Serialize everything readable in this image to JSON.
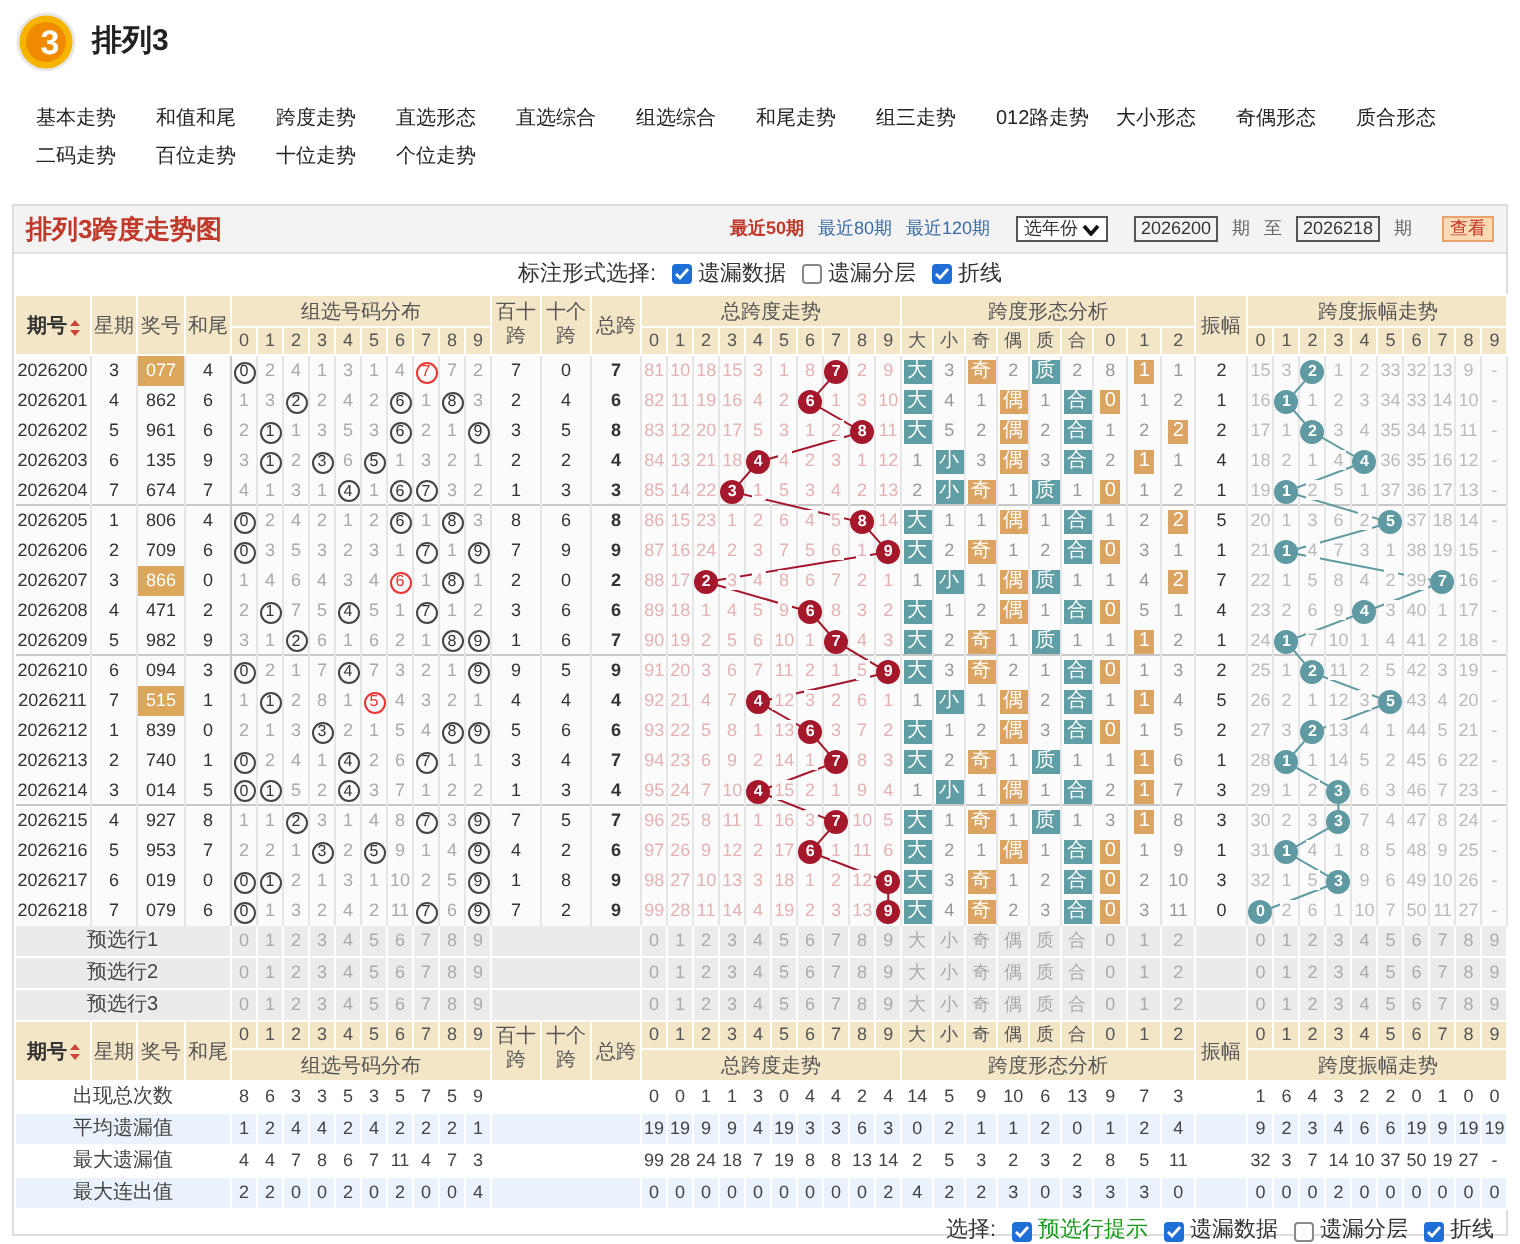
{
  "logo": {
    "text": "3"
  },
  "app_title": "排列3",
  "nav": [
    [
      "基本走势",
      "和值和尾",
      "跨度走势",
      "直选形态",
      "直选综合",
      "组选综合",
      "和尾走势",
      "组三走势",
      "012路走势",
      "大小形态",
      "奇偶形态",
      "质合形态"
    ],
    [
      "二码走势",
      "百位走势",
      "十位走势",
      "个位走势"
    ]
  ],
  "chart_title": "排列3跨度走势图",
  "ranges": [
    {
      "label": "最近50期",
      "selected": true
    },
    {
      "label": "最近80期",
      "selected": false
    },
    {
      "label": "最近120期",
      "selected": false
    }
  ],
  "year_select": "选年份",
  "from": "2026200",
  "period_unit_1": "期",
  "to_label": "至",
  "to": "2026218",
  "period_unit_2": "期",
  "view_button": "查看",
  "options_label": "标注形式选择:",
  "options": [
    {
      "label": "遗漏数据",
      "checked": true
    },
    {
      "label": "遗漏分层",
      "checked": false
    },
    {
      "label": "折线",
      "checked": true
    }
  ],
  "header": {
    "period": "期号",
    "week": "星期",
    "number": "奖号",
    "tail": "和尾",
    "dist_title": "组选号码分布",
    "dist_cols": [
      "0",
      "1",
      "2",
      "3",
      "4",
      "5",
      "6",
      "7",
      "8",
      "9"
    ],
    "bs": "百十跨",
    "sg": "十个跨",
    "span": "总跨",
    "span_title": "总跨度走势",
    "span_cols": [
      "0",
      "1",
      "2",
      "3",
      "4",
      "5",
      "6",
      "7",
      "8",
      "9"
    ],
    "form_title": "跨度形态分析",
    "form_cols": [
      "大",
      "小",
      "奇",
      "偶",
      "质",
      "合",
      "0",
      "1",
      "2"
    ],
    "amp": "振幅",
    "amp_title": "跨度振幅走势",
    "amp_cols": [
      "0",
      "1",
      "2",
      "3",
      "4",
      "5",
      "6",
      "7",
      "8",
      "9"
    ]
  },
  "rows": [
    {
      "period": "2026200",
      "week": "3",
      "number": "077",
      "highlight": true,
      "tail": "4",
      "dist": [
        {
          "text": "0",
          "kind": "hit"
        },
        "2",
        "4",
        "1",
        "3",
        "1",
        "4",
        {
          "text": "7",
          "kind": "double"
        },
        "7",
        "2"
      ],
      "bs": "7",
      "sg": "0",
      "span": "7",
      "span_trend": [
        "81",
        "10",
        "18",
        "15",
        "3",
        "1",
        "8",
        {
          "text": "7",
          "kind": "hit"
        },
        "2",
        "9"
      ],
      "form": [
        {
          "text": "大",
          "kind": "hit"
        },
        "3",
        {
          "text": "奇",
          "kind": "hit"
        },
        "2",
        {
          "text": "质",
          "kind": "hit"
        },
        "2",
        "8",
        {
          "text": "1",
          "kind": "hit"
        },
        "1"
      ],
      "amp": "2",
      "amp_trend": [
        "15",
        "3",
        {
          "text": "2",
          "kind": "hit"
        },
        "1",
        "2",
        "33",
        "32",
        "13",
        "9",
        "-"
      ]
    },
    {
      "period": "2026201",
      "week": "4",
      "number": "862",
      "highlight": false,
      "tail": "6",
      "dist": [
        "1",
        "3",
        {
          "text": "2",
          "kind": "hit"
        },
        "2",
        "4",
        "2",
        {
          "text": "6",
          "kind": "hit"
        },
        "1",
        {
          "text": "8",
          "kind": "hit"
        },
        "3"
      ],
      "bs": "2",
      "sg": "4",
      "span": "6",
      "span_trend": [
        "82",
        "11",
        "19",
        "16",
        "4",
        "2",
        {
          "text": "6",
          "kind": "hit"
        },
        "1",
        "3",
        "10"
      ],
      "form": [
        {
          "text": "大",
          "kind": "hit"
        },
        "4",
        "1",
        {
          "text": "偶",
          "kind": "hit"
        },
        "1",
        {
          "text": "合",
          "kind": "hit"
        },
        {
          "text": "0",
          "kind": "hit"
        },
        "1",
        "2"
      ],
      "amp": "1",
      "amp_trend": [
        "16",
        {
          "text": "1",
          "kind": "hit"
        },
        "1",
        "2",
        "3",
        "34",
        "33",
        "14",
        "10",
        "-"
      ]
    },
    {
      "period": "2026202",
      "week": "5",
      "number": "961",
      "highlight": false,
      "tail": "6",
      "dist": [
        "2",
        {
          "text": "1",
          "kind": "hit"
        },
        "1",
        "3",
        "5",
        "3",
        {
          "text": "6",
          "kind": "hit"
        },
        "2",
        "1",
        {
          "text": "9",
          "kind": "hit"
        }
      ],
      "bs": "3",
      "sg": "5",
      "span": "8",
      "span_trend": [
        "83",
        "12",
        "20",
        "17",
        "5",
        "3",
        "1",
        "2",
        {
          "text": "8",
          "kind": "hit"
        },
        "11"
      ],
      "form": [
        {
          "text": "大",
          "kind": "hit"
        },
        "5",
        "2",
        {
          "text": "偶",
          "kind": "hit"
        },
        "2",
        {
          "text": "合",
          "kind": "hit"
        },
        "1",
        "2",
        {
          "text": "2",
          "kind": "hit"
        }
      ],
      "amp": "2",
      "amp_trend": [
        "17",
        "1",
        {
          "text": "2",
          "kind": "hit"
        },
        "3",
        "4",
        "35",
        "34",
        "15",
        "11",
        "-"
      ]
    },
    {
      "period": "2026203",
      "week": "6",
      "number": "135",
      "highlight": false,
      "tail": "9",
      "dist": [
        "3",
        {
          "text": "1",
          "kind": "hit"
        },
        "2",
        {
          "text": "3",
          "kind": "hit"
        },
        "6",
        {
          "text": "5",
          "kind": "hit"
        },
        "1",
        "3",
        "2",
        "1"
      ],
      "bs": "2",
      "sg": "2",
      "span": "4",
      "span_trend": [
        "84",
        "13",
        "21",
        "18",
        {
          "text": "4",
          "kind": "hit"
        },
        "4",
        "2",
        "3",
        "1",
        "12"
      ],
      "form": [
        "1",
        {
          "text": "小",
          "kind": "hit"
        },
        "3",
        {
          "text": "偶",
          "kind": "hit"
        },
        "3",
        {
          "text": "合",
          "kind": "hit"
        },
        "2",
        {
          "text": "1",
          "kind": "hit"
        },
        "1"
      ],
      "amp": "4",
      "amp_trend": [
        "18",
        "2",
        "1",
        "4",
        {
          "text": "4",
          "kind": "hit"
        },
        "36",
        "35",
        "16",
        "12",
        "-"
      ]
    },
    {
      "period": "2026204",
      "week": "7",
      "number": "674",
      "highlight": false,
      "tail": "7",
      "dist": [
        "4",
        "1",
        "3",
        "1",
        {
          "text": "4",
          "kind": "hit"
        },
        "1",
        {
          "text": "6",
          "kind": "hit"
        },
        {
          "text": "7",
          "kind": "hit"
        },
        "3",
        "2"
      ],
      "bs": "1",
      "sg": "3",
      "span": "3",
      "span_trend": [
        "85",
        "14",
        "22",
        {
          "text": "3",
          "kind": "hit"
        },
        "1",
        "5",
        "3",
        "4",
        "2",
        "13"
      ],
      "form": [
        "2",
        {
          "text": "小",
          "kind": "hit"
        },
        {
          "text": "奇",
          "kind": "hit"
        },
        "1",
        {
          "text": "质",
          "kind": "hit"
        },
        "1",
        {
          "text": "0",
          "kind": "hit"
        },
        "1",
        "2"
      ],
      "amp": "1",
      "amp_trend": [
        "19",
        {
          "text": "1",
          "kind": "hit"
        },
        "2",
        "5",
        "1",
        "37",
        "36",
        "17",
        "13",
        "-"
      ]
    },
    {
      "period": "2026205",
      "week": "1",
      "number": "806",
      "highlight": false,
      "tail": "4",
      "dist": [
        {
          "text": "0",
          "kind": "hit"
        },
        "2",
        "4",
        "2",
        "1",
        "2",
        {
          "text": "6",
          "kind": "hit"
        },
        "1",
        {
          "text": "8",
          "kind": "hit"
        },
        "3"
      ],
      "bs": "8",
      "sg": "6",
      "span": "8",
      "span_trend": [
        "86",
        "15",
        "23",
        "1",
        "2",
        "6",
        "4",
        "5",
        {
          "text": "8",
          "kind": "hit"
        },
        "14"
      ],
      "form": [
        {
          "text": "大",
          "kind": "hit"
        },
        "1",
        "1",
        {
          "text": "偶",
          "kind": "hit"
        },
        "1",
        {
          "text": "合",
          "kind": "hit"
        },
        "1",
        "2",
        {
          "text": "2",
          "kind": "hit"
        }
      ],
      "amp": "5",
      "amp_trend": [
        "20",
        "1",
        "3",
        "6",
        "2",
        {
          "text": "5",
          "kind": "hit"
        },
        "37",
        "18",
        "14",
        "-"
      ]
    },
    {
      "period": "2026206",
      "week": "2",
      "number": "709",
      "highlight": false,
      "tail": "6",
      "dist": [
        {
          "text": "0",
          "kind": "hit"
        },
        "3",
        "5",
        "3",
        "2",
        "3",
        "1",
        {
          "text": "7",
          "kind": "hit"
        },
        "1",
        {
          "text": "9",
          "kind": "hit"
        }
      ],
      "bs": "7",
      "sg": "9",
      "span": "9",
      "span_trend": [
        "87",
        "16",
        "24",
        "2",
        "3",
        "7",
        "5",
        "6",
        "1",
        {
          "text": "9",
          "kind": "hit"
        }
      ],
      "form": [
        {
          "text": "大",
          "kind": "hit"
        },
        "2",
        {
          "text": "奇",
          "kind": "hit"
        },
        "1",
        "2",
        {
          "text": "合",
          "kind": "hit"
        },
        {
          "text": "0",
          "kind": "hit"
        },
        "3",
        "1"
      ],
      "amp": "1",
      "amp_trend": [
        "21",
        {
          "text": "1",
          "kind": "hit"
        },
        "4",
        "7",
        "3",
        "1",
        "38",
        "19",
        "15",
        "-"
      ]
    },
    {
      "period": "2026207",
      "week": "3",
      "number": "866",
      "highlight": true,
      "tail": "0",
      "dist": [
        "1",
        "4",
        "6",
        "4",
        "3",
        "4",
        {
          "text": "6",
          "kind": "double"
        },
        "1",
        {
          "text": "8",
          "kind": "hit"
        },
        "1"
      ],
      "bs": "2",
      "sg": "0",
      "span": "2",
      "span_trend": [
        "88",
        "17",
        {
          "text": "2",
          "kind": "hit"
        },
        "3",
        "4",
        "8",
        "6",
        "7",
        "2",
        "1"
      ],
      "form": [
        "1",
        {
          "text": "小",
          "kind": "hit"
        },
        "1",
        {
          "text": "偶",
          "kind": "hit"
        },
        {
          "text": "质",
          "kind": "hit"
        },
        "1",
        "1",
        "4",
        {
          "text": "2",
          "kind": "hit"
        }
      ],
      "amp": "7",
      "amp_trend": [
        "22",
        "1",
        "5",
        "8",
        "4",
        "2",
        "39",
        {
          "text": "7",
          "kind": "hit"
        },
        "16",
        "-"
      ]
    },
    {
      "period": "2026208",
      "week": "4",
      "number": "471",
      "highlight": false,
      "tail": "2",
      "dist": [
        "2",
        {
          "text": "1",
          "kind": "hit"
        },
        "7",
        "5",
        {
          "text": "4",
          "kind": "hit"
        },
        "5",
        "1",
        {
          "text": "7",
          "kind": "hit"
        },
        "1",
        "2"
      ],
      "bs": "3",
      "sg": "6",
      "span": "6",
      "span_trend": [
        "89",
        "18",
        "1",
        "4",
        "5",
        "9",
        {
          "text": "6",
          "kind": "hit"
        },
        "8",
        "3",
        "2"
      ],
      "form": [
        {
          "text": "大",
          "kind": "hit"
        },
        "1",
        "2",
        {
          "text": "偶",
          "kind": "hit"
        },
        "1",
        {
          "text": "合",
          "kind": "hit"
        },
        {
          "text": "0",
          "kind": "hit"
        },
        "5",
        "1"
      ],
      "amp": "4",
      "amp_trend": [
        "23",
        "2",
        "6",
        "9",
        {
          "text": "4",
          "kind": "hit"
        },
        "3",
        "40",
        "1",
        "17",
        "-"
      ]
    },
    {
      "period": "2026209",
      "week": "5",
      "number": "982",
      "highlight": false,
      "tail": "9",
      "dist": [
        "3",
        "1",
        {
          "text": "2",
          "kind": "hit"
        },
        "6",
        "1",
        "6",
        "2",
        "1",
        {
          "text": "8",
          "kind": "hit"
        },
        {
          "text": "9",
          "kind": "hit"
        }
      ],
      "bs": "1",
      "sg": "6",
      "span": "7",
      "span_trend": [
        "90",
        "19",
        "2",
        "5",
        "6",
        "10",
        "1",
        {
          "text": "7",
          "kind": "hit"
        },
        "4",
        "3"
      ],
      "form": [
        {
          "text": "大",
          "kind": "hit"
        },
        "2",
        {
          "text": "奇",
          "kind": "hit"
        },
        "1",
        {
          "text": "质",
          "kind": "hit"
        },
        "1",
        "1",
        {
          "text": "1",
          "kind": "hit"
        },
        "2"
      ],
      "amp": "1",
      "amp_trend": [
        "24",
        {
          "text": "1",
          "kind": "hit"
        },
        "7",
        "10",
        "1",
        "4",
        "41",
        "2",
        "18",
        "-"
      ]
    },
    {
      "period": "2026210",
      "week": "6",
      "number": "094",
      "highlight": false,
      "tail": "3",
      "dist": [
        {
          "text": "0",
          "kind": "hit"
        },
        "2",
        "1",
        "7",
        {
          "text": "4",
          "kind": "hit"
        },
        "7",
        "3",
        "2",
        "1",
        {
          "text": "9",
          "kind": "hit"
        }
      ],
      "bs": "9",
      "sg": "5",
      "span": "9",
      "span_trend": [
        "91",
        "20",
        "3",
        "6",
        "7",
        "11",
        "2",
        "1",
        "5",
        {
          "text": "9",
          "kind": "hit"
        }
      ],
      "form": [
        {
          "text": "大",
          "kind": "hit"
        },
        "3",
        {
          "text": "奇",
          "kind": "hit"
        },
        "2",
        "1",
        {
          "text": "合",
          "kind": "hit"
        },
        {
          "text": "0",
          "kind": "hit"
        },
        "1",
        "3"
      ],
      "amp": "2",
      "amp_trend": [
        "25",
        "1",
        {
          "text": "2",
          "kind": "hit"
        },
        "11",
        "2",
        "5",
        "42",
        "3",
        "19",
        "-"
      ]
    },
    {
      "period": "2026211",
      "week": "7",
      "number": "515",
      "highlight": true,
      "tail": "1",
      "dist": [
        "1",
        {
          "text": "1",
          "kind": "hit"
        },
        "2",
        "8",
        "1",
        {
          "text": "5",
          "kind": "double"
        },
        "4",
        "3",
        "2",
        "1"
      ],
      "bs": "4",
      "sg": "4",
      "span": "4",
      "span_trend": [
        "92",
        "21",
        "4",
        "7",
        {
          "text": "4",
          "kind": "hit"
        },
        "12",
        "3",
        "2",
        "6",
        "1"
      ],
      "form": [
        "1",
        {
          "text": "小",
          "kind": "hit"
        },
        "1",
        {
          "text": "偶",
          "kind": "hit"
        },
        "2",
        {
          "text": "合",
          "kind": "hit"
        },
        "1",
        {
          "text": "1",
          "kind": "hit"
        },
        "4"
      ],
      "amp": "5",
      "amp_trend": [
        "26",
        "2",
        "1",
        "12",
        "3",
        {
          "text": "5",
          "kind": "hit"
        },
        "43",
        "4",
        "20",
        "-"
      ]
    },
    {
      "period": "2026212",
      "week": "1",
      "number": "839",
      "highlight": false,
      "tail": "0",
      "dist": [
        "2",
        "1",
        "3",
        {
          "text": "3",
          "kind": "hit"
        },
        "2",
        "1",
        "5",
        "4",
        {
          "text": "8",
          "kind": "hit"
        },
        {
          "text": "9",
          "kind": "hit"
        }
      ],
      "bs": "5",
      "sg": "6",
      "span": "6",
      "span_trend": [
        "93",
        "22",
        "5",
        "8",
        "1",
        "13",
        {
          "text": "6",
          "kind": "hit"
        },
        "3",
        "7",
        "2"
      ],
      "form": [
        {
          "text": "大",
          "kind": "hit"
        },
        "1",
        "2",
        {
          "text": "偶",
          "kind": "hit"
        },
        "3",
        {
          "text": "合",
          "kind": "hit"
        },
        {
          "text": "0",
          "kind": "hit"
        },
        "1",
        "5"
      ],
      "amp": "2",
      "amp_trend": [
        "27",
        "3",
        {
          "text": "2",
          "kind": "hit"
        },
        "13",
        "4",
        "1",
        "44",
        "5",
        "21",
        "-"
      ]
    },
    {
      "period": "2026213",
      "week": "2",
      "number": "740",
      "highlight": false,
      "tail": "1",
      "dist": [
        {
          "text": "0",
          "kind": "hit"
        },
        "2",
        "4",
        "1",
        {
          "text": "4",
          "kind": "hit"
        },
        "2",
        "6",
        {
          "text": "7",
          "kind": "hit"
        },
        "1",
        "1"
      ],
      "bs": "3",
      "sg": "4",
      "span": "7",
      "span_trend": [
        "94",
        "23",
        "6",
        "9",
        "2",
        "14",
        "1",
        {
          "text": "7",
          "kind": "hit"
        },
        "8",
        "3"
      ],
      "form": [
        {
          "text": "大",
          "kind": "hit"
        },
        "2",
        {
          "text": "奇",
          "kind": "hit"
        },
        "1",
        {
          "text": "质",
          "kind": "hit"
        },
        "1",
        "1",
        {
          "text": "1",
          "kind": "hit"
        },
        "6"
      ],
      "amp": "1",
      "amp_trend": [
        "28",
        {
          "text": "1",
          "kind": "hit"
        },
        "1",
        "14",
        "5",
        "2",
        "45",
        "6",
        "22",
        "-"
      ]
    },
    {
      "period": "2026214",
      "week": "3",
      "number": "014",
      "highlight": false,
      "tail": "5",
      "dist": [
        {
          "text": "0",
          "kind": "hit"
        },
        {
          "text": "1",
          "kind": "hit"
        },
        "5",
        "2",
        {
          "text": "4",
          "kind": "hit"
        },
        "3",
        "7",
        "1",
        "2",
        "2"
      ],
      "bs": "1",
      "sg": "3",
      "span": "4",
      "span_trend": [
        "95",
        "24",
        "7",
        "10",
        {
          "text": "4",
          "kind": "hit"
        },
        "15",
        "2",
        "1",
        "9",
        "4"
      ],
      "form": [
        "1",
        {
          "text": "小",
          "kind": "hit"
        },
        "1",
        {
          "text": "偶",
          "kind": "hit"
        },
        "1",
        {
          "text": "合",
          "kind": "hit"
        },
        "2",
        {
          "text": "1",
          "kind": "hit"
        },
        "7"
      ],
      "amp": "3",
      "amp_trend": [
        "29",
        "1",
        "2",
        {
          "text": "3",
          "kind": "hit"
        },
        "6",
        "3",
        "46",
        "7",
        "23",
        "-"
      ]
    },
    {
      "period": "2026215",
      "week": "4",
      "number": "927",
      "highlight": false,
      "tail": "8",
      "dist": [
        "1",
        "1",
        {
          "text": "2",
          "kind": "hit"
        },
        "3",
        "1",
        "4",
        "8",
        {
          "text": "7",
          "kind": "hit"
        },
        "3",
        {
          "text": "9",
          "kind": "hit"
        }
      ],
      "bs": "7",
      "sg": "5",
      "span": "7",
      "span_trend": [
        "96",
        "25",
        "8",
        "11",
        "1",
        "16",
        "3",
        {
          "text": "7",
          "kind": "hit"
        },
        "10",
        "5"
      ],
      "form": [
        {
          "text": "大",
          "kind": "hit"
        },
        "1",
        {
          "text": "奇",
          "kind": "hit"
        },
        "1",
        {
          "text": "质",
          "kind": "hit"
        },
        "1",
        "3",
        {
          "text": "1",
          "kind": "hit"
        },
        "8"
      ],
      "amp": "3",
      "amp_trend": [
        "30",
        "2",
        "3",
        {
          "text": "3",
          "kind": "hit"
        },
        "7",
        "4",
        "47",
        "8",
        "24",
        "-"
      ]
    },
    {
      "period": "2026216",
      "week": "5",
      "number": "953",
      "highlight": false,
      "tail": "7",
      "dist": [
        "2",
        "2",
        "1",
        {
          "text": "3",
          "kind": "hit"
        },
        "2",
        {
          "text": "5",
          "kind": "hit"
        },
        "9",
        "1",
        "4",
        {
          "text": "9",
          "kind": "hit"
        }
      ],
      "bs": "4",
      "sg": "2",
      "span": "6",
      "span_trend": [
        "97",
        "26",
        "9",
        "12",
        "2",
        "17",
        {
          "text": "6",
          "kind": "hit"
        },
        "1",
        "11",
        "6"
      ],
      "form": [
        {
          "text": "大",
          "kind": "hit"
        },
        "2",
        "1",
        {
          "text": "偶",
          "kind": "hit"
        },
        "1",
        {
          "text": "合",
          "kind": "hit"
        },
        {
          "text": "0",
          "kind": "hit"
        },
        "1",
        "9"
      ],
      "amp": "1",
      "amp_trend": [
        "31",
        {
          "text": "1",
          "kind": "hit"
        },
        "4",
        "1",
        "8",
        "5",
        "48",
        "9",
        "25",
        "-"
      ]
    },
    {
      "period": "2026217",
      "week": "6",
      "number": "019",
      "highlight": false,
      "tail": "0",
      "dist": [
        {
          "text": "0",
          "kind": "hit"
        },
        {
          "text": "1",
          "kind": "hit"
        },
        "2",
        "1",
        "3",
        "1",
        "10",
        "2",
        "5",
        {
          "text": "9",
          "kind": "hit"
        }
      ],
      "bs": "1",
      "sg": "8",
      "span": "9",
      "span_trend": [
        "98",
        "27",
        "10",
        "13",
        "3",
        "18",
        "1",
        "2",
        "12",
        {
          "text": "9",
          "kind": "hit"
        }
      ],
      "form": [
        {
          "text": "大",
          "kind": "hit"
        },
        "3",
        {
          "text": "奇",
          "kind": "hit"
        },
        "1",
        "2",
        {
          "text": "合",
          "kind": "hit"
        },
        {
          "text": "0",
          "kind": "hit"
        },
        "2",
        "10"
      ],
      "amp": "3",
      "amp_trend": [
        "32",
        "1",
        "5",
        {
          "text": "3",
          "kind": "hit"
        },
        "9",
        "6",
        "49",
        "10",
        "26",
        "-"
      ]
    },
    {
      "period": "2026218",
      "week": "7",
      "number": "079",
      "highlight": false,
      "tail": "6",
      "dist": [
        {
          "text": "0",
          "kind": "hit"
        },
        "1",
        "3",
        "2",
        "4",
        "2",
        "11",
        {
          "text": "7",
          "kind": "hit"
        },
        "6",
        {
          "text": "9",
          "kind": "hit"
        }
      ],
      "bs": "7",
      "sg": "2",
      "span": "9",
      "span_trend": [
        "99",
        "28",
        "11",
        "14",
        "4",
        "19",
        "2",
        "3",
        "13",
        {
          "text": "9",
          "kind": "hit"
        }
      ],
      "form": [
        {
          "text": "大",
          "kind": "hit"
        },
        "4",
        {
          "text": "奇",
          "kind": "hit"
        },
        "2",
        "3",
        {
          "text": "合",
          "kind": "hit"
        },
        {
          "text": "0",
          "kind": "hit"
        },
        "3",
        "11"
      ],
      "amp": "0",
      "amp_trend": [
        {
          "text": "0",
          "kind": "hit"
        },
        "2",
        "6",
        "1",
        "10",
        "7",
        "50",
        "11",
        "27",
        "-"
      ]
    }
  ],
  "preselect": [
    {
      "label": "预选行1",
      "dist": [
        "0",
        "1",
        "2",
        "3",
        "4",
        "5",
        "6",
        "7",
        "8",
        "9"
      ],
      "span": [
        "0",
        "1",
        "2",
        "3",
        "4",
        "5",
        "6",
        "7",
        "8",
        "9"
      ],
      "form": [
        "大",
        "小",
        "奇",
        "偶",
        "质",
        "合",
        "0",
        "1",
        "2"
      ],
      "amp": [
        "0",
        "1",
        "2",
        "3",
        "4",
        "5",
        "6",
        "7",
        "8",
        "9"
      ]
    },
    {
      "label": "预选行2",
      "dist": [
        "0",
        "1",
        "2",
        "3",
        "4",
        "5",
        "6",
        "7",
        "8",
        "9"
      ],
      "span": [
        "0",
        "1",
        "2",
        "3",
        "4",
        "5",
        "6",
        "7",
        "8",
        "9"
      ],
      "form": [
        "大",
        "小",
        "奇",
        "偶",
        "质",
        "合",
        "0",
        "1",
        "2"
      ],
      "amp": [
        "0",
        "1",
        "2",
        "3",
        "4",
        "5",
        "6",
        "7",
        "8",
        "9"
      ]
    },
    {
      "label": "预选行3",
      "dist": [
        "0",
        "1",
        "2",
        "3",
        "4",
        "5",
        "6",
        "7",
        "8",
        "9"
      ],
      "span": [
        "0",
        "1",
        "2",
        "3",
        "4",
        "5",
        "6",
        "7",
        "8",
        "9"
      ],
      "form": [
        "大",
        "小",
        "奇",
        "偶",
        "质",
        "合",
        "0",
        "1",
        "2"
      ],
      "amp": [
        "0",
        "1",
        "2",
        "3",
        "4",
        "5",
        "6",
        "7",
        "8",
        "9"
      ]
    }
  ],
  "footer_header": {
    "period": "期号",
    "week": "星期",
    "number": "奖号",
    "tail": "和尾",
    "dist_title": "组选号码分布",
    "dist_cols": [
      "0",
      "1",
      "2",
      "3",
      "4",
      "5",
      "6",
      "7",
      "8",
      "9"
    ],
    "bs": "百十跨",
    "sg": "十个跨",
    "span": "总跨",
    "span_title": "总跨度走势",
    "span_cols": [
      "0",
      "1",
      "2",
      "3",
      "4",
      "5",
      "6",
      "7",
      "8",
      "9"
    ],
    "form_title": "跨度形态分析",
    "form_cols": [
      "大",
      "小",
      "奇",
      "偶",
      "质",
      "合",
      "0",
      "1",
      "2"
    ],
    "amp": "振幅",
    "amp_title": "跨度振幅走势",
    "amp_cols": [
      "0",
      "1",
      "2",
      "3",
      "4",
      "5",
      "6",
      "7",
      "8",
      "9"
    ]
  },
  "stats": [
    {
      "label": "出现总次数",
      "dist": [
        "8",
        "6",
        "3",
        "3",
        "5",
        "3",
        "5",
        "7",
        "5",
        "9"
      ],
      "span": [
        "0",
        "0",
        "1",
        "1",
        "3",
        "0",
        "4",
        "4",
        "2",
        "4"
      ],
      "form": [
        "14",
        "5",
        "9",
        "10",
        "6",
        "13",
        "9",
        "7",
        "3"
      ],
      "amp": [
        "1",
        "6",
        "4",
        "3",
        "2",
        "2",
        "0",
        "1",
        "0",
        "0"
      ]
    },
    {
      "label": "平均遗漏值",
      "dist": [
        "1",
        "2",
        "4",
        "4",
        "2",
        "4",
        "2",
        "2",
        "2",
        "1"
      ],
      "span": [
        "19",
        "19",
        "9",
        "9",
        "4",
        "19",
        "3",
        "3",
        "6",
        "3"
      ],
      "form": [
        "0",
        "2",
        "1",
        "1",
        "2",
        "0",
        "1",
        "2",
        "4"
      ],
      "amp": [
        "9",
        "2",
        "3",
        "4",
        "6",
        "6",
        "19",
        "9",
        "19",
        "19"
      ]
    },
    {
      "label": "最大遗漏值",
      "dist": [
        "4",
        "4",
        "7",
        "8",
        "6",
        "7",
        "11",
        "4",
        "7",
        "3"
      ],
      "span": [
        "99",
        "28",
        "24",
        "18",
        "7",
        "19",
        "8",
        "8",
        "13",
        "14"
      ],
      "form": [
        "2",
        "5",
        "3",
        "2",
        "3",
        "2",
        "8",
        "5",
        "11"
      ],
      "amp": [
        "32",
        "3",
        "7",
        "14",
        "10",
        "37",
        "50",
        "19",
        "27",
        "-"
      ]
    },
    {
      "label": "最大连出值",
      "dist": [
        "2",
        "2",
        "0",
        "0",
        "2",
        "0",
        "2",
        "0",
        "0",
        "4"
      ],
      "span": [
        "0",
        "0",
        "0",
        "0",
        "0",
        "0",
        "0",
        "0",
        "0",
        "2"
      ],
      "form": [
        "4",
        "2",
        "2",
        "3",
        "0",
        "3",
        "3",
        "3",
        "0"
      ],
      "amp": [
        "0",
        "0",
        "0",
        "2",
        "0",
        "0",
        "0",
        "0",
        "0",
        "0"
      ]
    }
  ],
  "bottom_label": "选择:",
  "bottom_options": [
    {
      "label": "预选行提示",
      "checked": true
    },
    {
      "label": "遗漏数据",
      "checked": true
    },
    {
      "label": "遗漏分层",
      "checked": false
    },
    {
      "label": "折线",
      "checked": true
    }
  ]
}
